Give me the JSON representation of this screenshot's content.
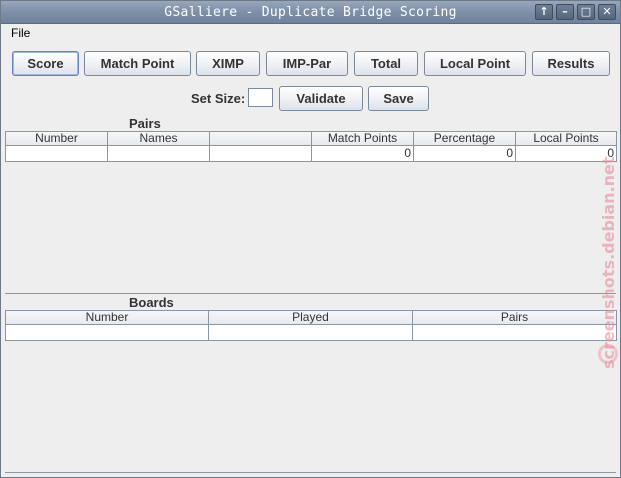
{
  "window": {
    "title": "GSalliere - Duplicate Bridge Scoring",
    "controls": [
      "↑",
      "–",
      "□",
      "✕"
    ]
  },
  "menu": {
    "file": "File"
  },
  "toolbar": {
    "score": "Score",
    "match_point": "Match Point",
    "ximp": "XIMP",
    "imp_par": "IMP-Par",
    "total": "Total",
    "local_point": "Local Point",
    "results": "Results"
  },
  "setsize": {
    "label": "Set Size:",
    "value": "",
    "validate": "Validate",
    "save": "Save"
  },
  "pairs": {
    "title": "Pairs",
    "columns": [
      "Number",
      "Names",
      "",
      "Match Points",
      "Percentage",
      "Local Points"
    ],
    "row": [
      "",
      "",
      "",
      "0",
      "0",
      "0"
    ]
  },
  "boards": {
    "title": "Boards",
    "columns": [
      "Number",
      "Played",
      "Pairs"
    ],
    "row": [
      "",
      "",
      ""
    ]
  },
  "watermark": "screenshots.debian.net",
  "colors": {
    "titlebar": "#7e8fa8",
    "background": "#eeeeee",
    "grid": "#8a96a3",
    "button_border": "#7a8a99"
  }
}
